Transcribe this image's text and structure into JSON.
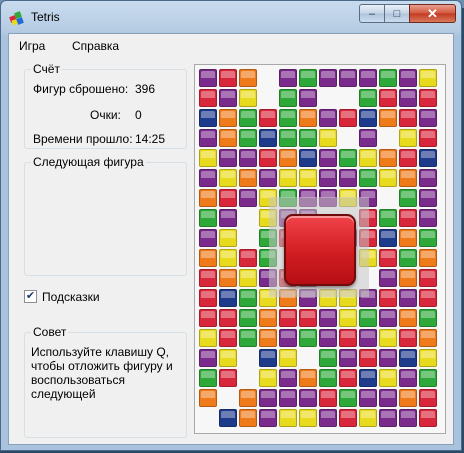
{
  "window": {
    "title": "Tetris",
    "minimize_glyph": "–",
    "maximize_glyph": "□",
    "close_glyph": "✕"
  },
  "menu": {
    "items": [
      "Игра",
      "Справка"
    ]
  },
  "score": {
    "title": "Счёт",
    "rows": [
      {
        "label": "Фигур сброшено:",
        "value": "396"
      },
      {
        "label": "Очки:",
        "value": "0"
      },
      {
        "label": "Времени прошло:",
        "value": "14:25"
      }
    ]
  },
  "next_piece": {
    "title": "Следующая фигура"
  },
  "hints": {
    "label": "Подсказки",
    "checked": true,
    "check_glyph": "✔"
  },
  "tip": {
    "title": "Совет",
    "text": "Используйте клавишу Q,\nчтобы отложить фигуру и\nвоспользоваться\nследующей"
  },
  "board": {
    "columns": 12,
    "rows": 18,
    "palette": {
      "P": "#7a2a8a",
      "R": "#d8263a",
      "O": "#ee7a1a",
      "G": "#2ea838",
      "Y": "#e8da1c",
      "N": "#1e3a8a"
    },
    "grid": [
      "PRO.PGPPPGPY",
      "RPY.GP..GRPR",
      "NOGRGOPRNORP",
      "POGNGGY.P.YR",
      "YPPRONPGYORN",
      "PYOPYYPPGYOP",
      "ORPYGPPYP.GP",
      "GP.YPP..RGRP",
      "PY.GRYOPRNOG",
      "OYRG....YRGO",
      "ROYPRP...POR",
      "RNGYOPYYPRPR",
      "RRGORRPYGPOG",
      "YRGOPGPRPYRO",
      "PY.NY.GPRPNY",
      "GR.YPOGRNYPG",
      "O.OPPPRGPPOR",
      ".NOPYYPRYPPR"
    ],
    "active_piece_color": "#d8263a"
  }
}
